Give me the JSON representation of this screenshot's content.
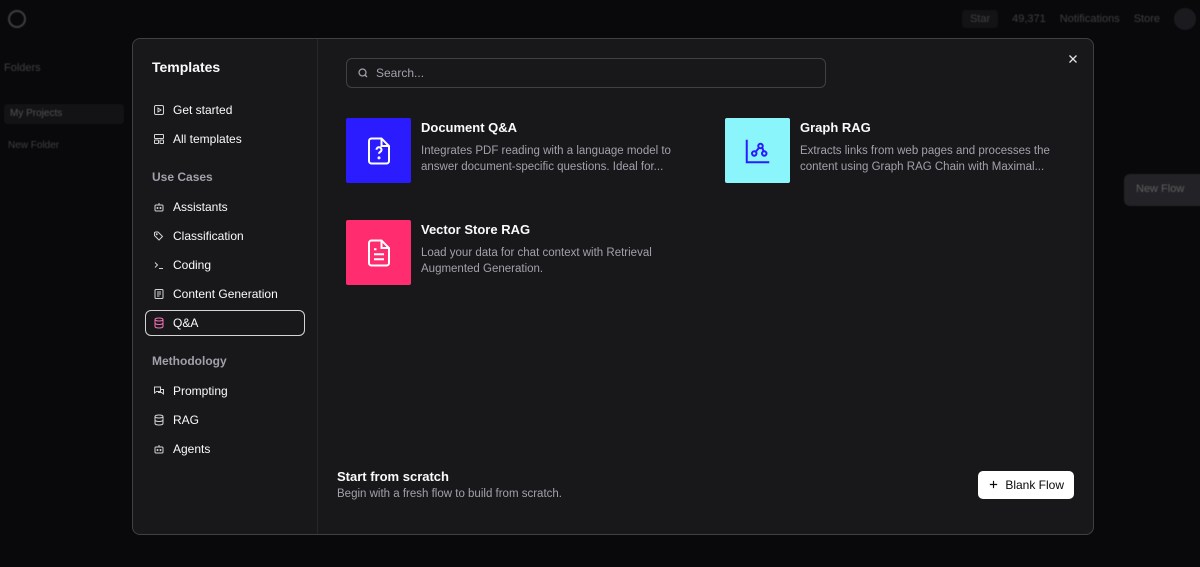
{
  "background": {
    "topbar": [
      "Star",
      "49,371",
      "Notifications",
      "Store"
    ],
    "sidebar": {
      "folders_label": "Folders",
      "my_projects": "My Projects",
      "new_folder": "New Folder"
    },
    "new_flow_button": "New Flow"
  },
  "modal": {
    "sidebar": {
      "title": "Templates",
      "top_items": [
        {
          "label": "Get started",
          "icon": "play-square-icon"
        },
        {
          "label": "All templates",
          "icon": "layout-grid-icon"
        }
      ],
      "use_cases_title": "Use Cases",
      "use_cases": [
        {
          "label": "Assistants",
          "icon": "bot-icon"
        },
        {
          "label": "Classification",
          "icon": "tags-icon"
        },
        {
          "label": "Coding",
          "icon": "terminal-icon"
        },
        {
          "label": "Content Generation",
          "icon": "newspaper-icon"
        },
        {
          "label": "Q&A",
          "icon": "database-icon",
          "active": true
        }
      ],
      "methodology_title": "Methodology",
      "methodology": [
        {
          "label": "Prompting",
          "icon": "messages-icon"
        },
        {
          "label": "RAG",
          "icon": "database-icon"
        },
        {
          "label": "Agents",
          "icon": "bot-icon"
        }
      ]
    },
    "search": {
      "placeholder": "Search..."
    },
    "cards": [
      {
        "title": "Document Q&A",
        "description": "Integrates PDF reading with a language model to answer document-specific questions. Ideal for...",
        "icon": "file-question-icon",
        "color": "#2b1bff",
        "icon_color": "#ffffff"
      },
      {
        "title": "Graph RAG",
        "description": "Extracts links from web pages and processes the content using Graph RAG Chain with Maximal...",
        "icon": "chart-scatter-icon",
        "color": "#8af6fc",
        "icon_color": "#2b1bff"
      },
      {
        "title": "Vector Store RAG",
        "description": "Load your data for chat context with Retrieval Augmented Generation.",
        "icon": "file-text-icon",
        "color": "#ff2d6f",
        "icon_color": "#ffffff"
      }
    ],
    "footer": {
      "title": "Start from scratch",
      "subtitle": "Begin with a fresh flow to build from scratch.",
      "button": "Blank Flow"
    }
  }
}
